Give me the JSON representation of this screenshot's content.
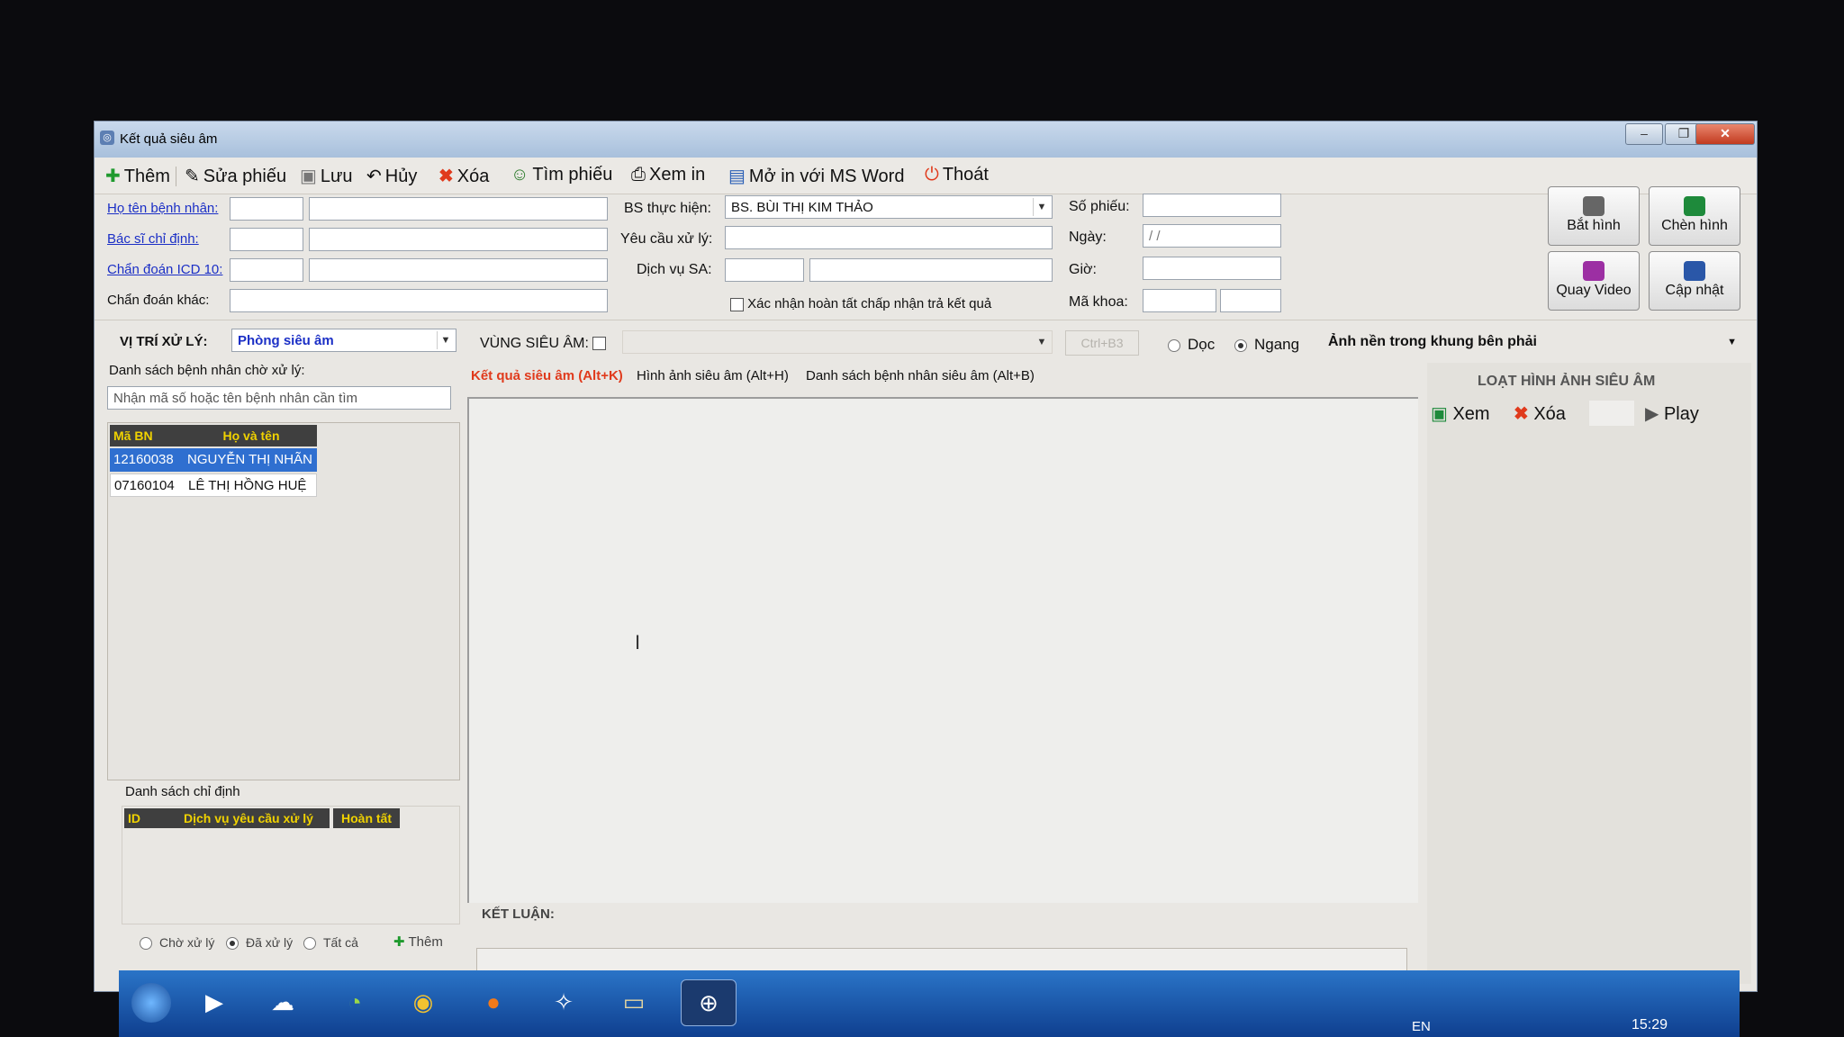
{
  "window": {
    "title": "Kết quả siêu âm"
  },
  "toolbar": {
    "them": "Thêm",
    "sua_phieu": "Sửa phiếu",
    "luu": "Lưu",
    "huy": "Hủy",
    "xoa": "Xóa",
    "tim_phieu": "Tìm phiếu",
    "xem_in": "Xem in",
    "mo_in_word": "Mở in với MS Word",
    "thoat": "Thoát"
  },
  "form": {
    "ho_ten_label": "Họ tên bệnh nhân:",
    "bac_si_chi_dinh_label": "Bác sĩ chỉ định:",
    "chan_doan_icd_label": "Chẩn đoán ICD 10:",
    "chan_doan_khac_label": "Chẩn đoán khác:",
    "bs_thuc_hien_label": "BS thực hiện:",
    "bs_thuc_hien_value": "BS. BÙI THỊ KIM THẢO",
    "yeu_cau_label": "Yêu cầu xử lý:",
    "dich_vu_label": "Dịch vụ SA:",
    "xac_nhan_label": "Xác nhận hoàn tất chấp nhận trả kết quả",
    "so_phieu_label": "Số phiếu:",
    "ngay_label": "Ngày:",
    "ngay_value": "/ /",
    "gio_label": "Giờ:",
    "ma_khoa_label": "Mã khoa:"
  },
  "actions": {
    "bat_hinh": "Bắt hình",
    "chen_hinh": "Chèn hình",
    "quay_video": "Quay Video",
    "cap_nhat": "Cập nhật"
  },
  "location": {
    "vi_tri_label": "VỊ TRÍ XỬ LÝ:",
    "vi_tri_value": "Phòng siêu âm",
    "vung_label": "VÙNG SIÊU ÂM:",
    "ctrl_label": "Ctrl+B3",
    "doc": "Dọc",
    "ngang": "Ngang",
    "anh_nen": "Ảnh nền trong khung bên phải"
  },
  "patients": {
    "title": "Danh sách bệnh nhân chờ xử lý:",
    "search_placeholder": "Nhận mã số hoặc tên bệnh nhân cần tìm",
    "headers": [
      "Mã BN",
      "Họ và tên"
    ],
    "rows": [
      {
        "id": "12160038",
        "name": "NGUYỄN THỊ NHÃN"
      },
      {
        "id": "07160104",
        "name": "LÊ THỊ HỒNG HUỆ"
      }
    ]
  },
  "orders": {
    "title": "Danh sách chỉ định",
    "headers": [
      "ID",
      "Dịch vụ yêu cầu xử lý",
      "Hoàn tất"
    ]
  },
  "filters": {
    "cho_xu_ly": "Chờ xử lý",
    "da_xu_ly": "Đã xử lý",
    "tat_ca": "Tất cả",
    "them": "Thêm"
  },
  "tabs": {
    "ket_qua": "Kết quả siêu âm (Alt+K)",
    "hinh_anh": "Hình ảnh siêu âm (Alt+H)",
    "danh_sach": "Danh sách bệnh nhân siêu âm (Alt+B)"
  },
  "ket_luan_label": "KẾT LUẬN:",
  "images_panel": {
    "title": "LOẠT HÌNH ẢNH SIÊU ÂM",
    "xem": "Xem",
    "xoa": "Xóa",
    "play": "Play"
  },
  "tray": {
    "lang": "EN",
    "time": "15:29"
  },
  "colors": {
    "accent_red": "#e03a1c",
    "link_blue": "#1b2fc6",
    "selection": "#2f6fd0",
    "header_yellow": "#f0d200"
  }
}
